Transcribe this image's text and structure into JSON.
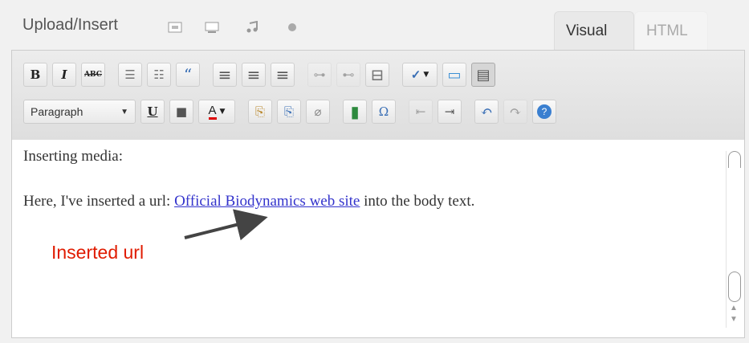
{
  "header": {
    "upload_label": "Upload/Insert",
    "media_icons": [
      "image-icon",
      "video-icon",
      "audio-icon",
      "media-icon"
    ]
  },
  "tabs": {
    "visual": "Visual",
    "html": "HTML"
  },
  "toolbar": {
    "row1": [
      {
        "name": "bold-button",
        "glyph": "B",
        "icon": "bold-icon"
      },
      {
        "name": "italic-button",
        "glyph": "I",
        "icon": "italic-icon"
      },
      {
        "name": "strikethrough-button",
        "glyph": "ABC",
        "icon": "strikethrough-icon"
      },
      {
        "name": "bullet-list-button",
        "glyph": "☰",
        "icon": "bullet-list-icon"
      },
      {
        "name": "numbered-list-button",
        "glyph": "☷",
        "icon": "numbered-list-icon"
      },
      {
        "name": "blockquote-button",
        "glyph": "“",
        "icon": "blockquote-icon"
      },
      {
        "name": "align-left-button",
        "glyph": "≡",
        "icon": "align-left-icon"
      },
      {
        "name": "align-center-button",
        "glyph": "≡",
        "icon": "align-center-icon"
      },
      {
        "name": "align-right-button",
        "glyph": "≡",
        "icon": "align-right-icon"
      },
      {
        "name": "insert-link-button",
        "glyph": "⊶",
        "icon": "link-icon"
      },
      {
        "name": "unlink-button",
        "glyph": "⊷",
        "icon": "unlink-icon"
      },
      {
        "name": "more-tag-button",
        "glyph": "⊟",
        "icon": "more-tag-icon"
      },
      {
        "name": "spellcheck-button",
        "glyph": "✓",
        "icon": "spellcheck-icon"
      },
      {
        "name": "fullscreen-button",
        "glyph": "▭",
        "icon": "fullscreen-icon"
      },
      {
        "name": "kitchen-sink-button",
        "glyph": "▤",
        "icon": "kitchen-sink-icon"
      }
    ],
    "format_select": "Paragraph",
    "row2": [
      {
        "name": "underline-button",
        "glyph": "U",
        "icon": "underline-icon"
      },
      {
        "name": "justify-button",
        "glyph": "■",
        "icon": "justify-icon"
      },
      {
        "name": "text-color-button",
        "glyph": "A",
        "icon": "text-color-icon"
      },
      {
        "name": "paste-text-button",
        "glyph": "⎘",
        "icon": "paste-text-icon"
      },
      {
        "name": "paste-word-button",
        "glyph": "⎘",
        "icon": "paste-word-icon"
      },
      {
        "name": "remove-format-button",
        "glyph": "⌀",
        "icon": "eraser-icon"
      },
      {
        "name": "insert-media-button",
        "glyph": "▮",
        "icon": "media-icon"
      },
      {
        "name": "special-char-button",
        "glyph": "Ω",
        "icon": "omega-icon"
      },
      {
        "name": "outdent-button",
        "glyph": "⇤",
        "icon": "outdent-icon"
      },
      {
        "name": "indent-button",
        "glyph": "⇥",
        "icon": "indent-icon"
      },
      {
        "name": "undo-button",
        "glyph": "↶",
        "icon": "undo-icon"
      },
      {
        "name": "redo-button",
        "glyph": "↷",
        "icon": "redo-icon"
      },
      {
        "name": "help-button",
        "glyph": "?",
        "icon": "help-icon"
      }
    ]
  },
  "editor": {
    "line1": "Inserting media:",
    "line2_before": "Here, I've inserted a url:  ",
    "link_text": "Official Biodynamics web site",
    "line2_after": " into the body text."
  },
  "annotation": {
    "label": "Inserted url",
    "color": "#e01b00"
  }
}
